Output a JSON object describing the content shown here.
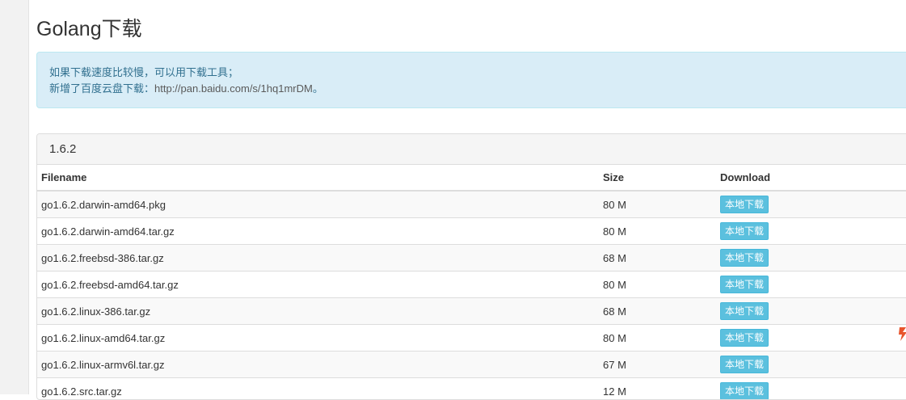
{
  "page": {
    "title": "Golang下载"
  },
  "notice": {
    "line1": "如果下载速度比较慢，可以用下载工具；",
    "line2_prefix": "新增了百度云盘下载：",
    "line2_link": "http://pan.baidu.com/s/1hq1mrDM",
    "line2_suffix": "。"
  },
  "panel": {
    "version": "1.6.2",
    "columns": [
      "Filename",
      "Size",
      "Download"
    ],
    "download_label": "本地下载",
    "rows": [
      {
        "filename": "go1.6.2.darwin-amd64.pkg",
        "size": "80 M"
      },
      {
        "filename": "go1.6.2.darwin-amd64.tar.gz",
        "size": "80 M"
      },
      {
        "filename": "go1.6.2.freebsd-386.tar.gz",
        "size": "68 M"
      },
      {
        "filename": "go1.6.2.freebsd-amd64.tar.gz",
        "size": "80 M"
      },
      {
        "filename": "go1.6.2.linux-386.tar.gz",
        "size": "68 M"
      },
      {
        "filename": "go1.6.2.linux-amd64.tar.gz",
        "size": "80 M"
      },
      {
        "filename": "go1.6.2.linux-armv6l.tar.gz",
        "size": "67 M"
      },
      {
        "filename": "go1.6.2.src.tar.gz",
        "size": "12 M"
      }
    ]
  },
  "colors": {
    "notice_bg": "#d9edf7",
    "notice_text": "#31708f",
    "button_bg": "#5bc0de",
    "floating_icon": "#e8542c"
  },
  "icons": {
    "floating": "floating-widget-icon"
  }
}
